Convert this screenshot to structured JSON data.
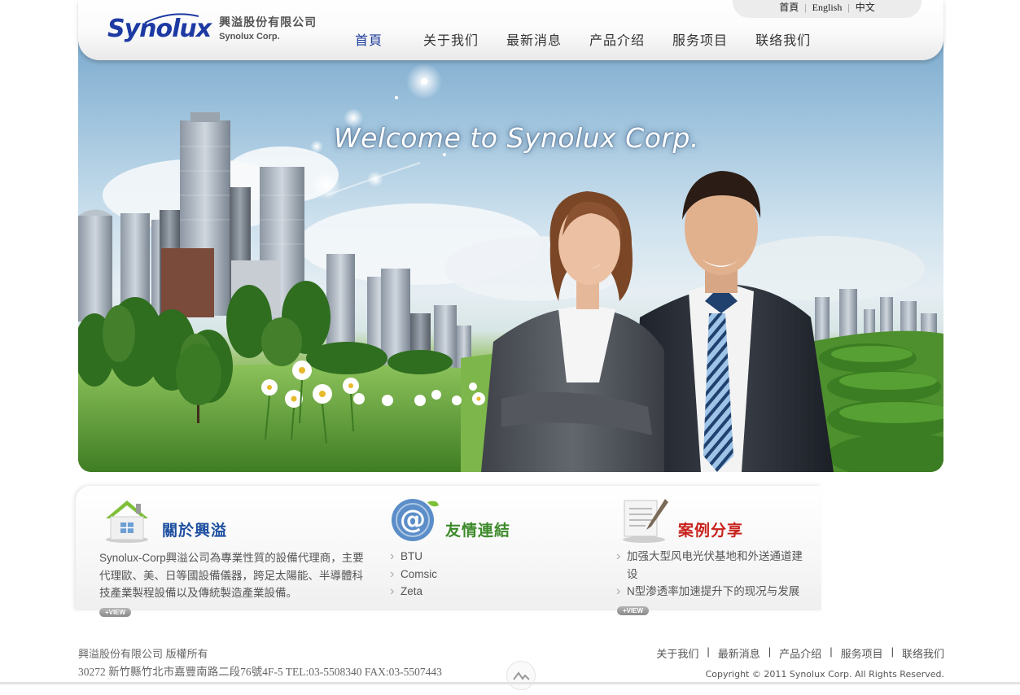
{
  "header": {
    "logo_mark": "Synolux",
    "logo_cn": "興溢股份有限公司",
    "logo_en": "Synolux Corp.",
    "lang": [
      "首頁",
      "English",
      "中文"
    ],
    "nav": [
      "首頁",
      "关于我们",
      "最新消息",
      "产品介绍",
      "服务项目",
      "联络我们"
    ],
    "active_nav": "首頁",
    "active_color": "#1e3c9c"
  },
  "banner": {
    "welcome": "Welcome to Synolux Corp."
  },
  "info": {
    "about": {
      "title": "關於興溢",
      "title_color": "#1e4fa0",
      "icon": "house-icon",
      "text": "Synolux-Corp興溢公司為專業性質的設備代理商，主要代理歐、美、日等國設備儀器，跨足太陽能、半導體科技產業製程設備以及傳統製造產業設備。",
      "view": "+VIEW"
    },
    "links": {
      "title": "友情連結",
      "title_color": "#3d8a2a",
      "icon": "at-sign-icon",
      "items": [
        "BTU",
        "Comsic",
        "Zeta"
      ]
    },
    "cases": {
      "title": "案例分享",
      "title_color": "#c8221c",
      "icon": "notepad-icon",
      "items": [
        "加强大型风电光伏基地和外送通道建设",
        "N型渗透率加速提升下的现况与发展"
      ],
      "view": "+VIEW"
    }
  },
  "footer": {
    "company": "興溢股份有限公司 版權所有",
    "address": "30272 新竹縣竹北市嘉豐南路二段76號4F-5 TEL:03-5508340 FAX:03-5507443",
    "nav": [
      "关于我们",
      "最新消息",
      "产品介绍",
      "服务项目",
      "联络我们"
    ],
    "copyright": "Copyright © 2011 Synolux Corp. All Rights Reserved.",
    "top_icon": "scroll-top-icon"
  }
}
